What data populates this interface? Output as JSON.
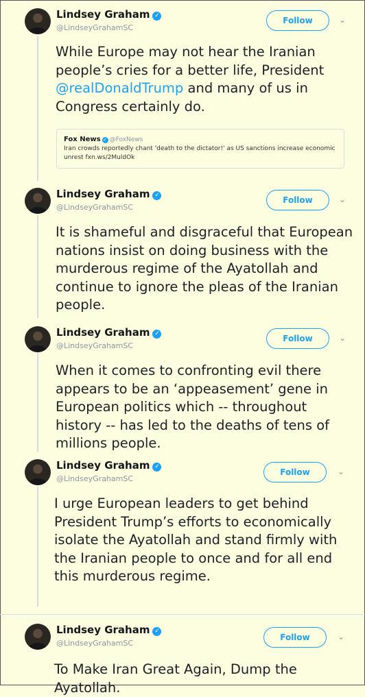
{
  "tweets": [
    {
      "name": "Lindsey Graham",
      "handle": "@LindseyGrahamSC",
      "follow_label": "Follow",
      "text_before": "While Europe may not hear the Iranian people’s cries for a better life, President ",
      "mention": "@realDonaldTrump",
      "text_after": " and many of us in Congress certainly do.",
      "quote": {
        "name": "Fox News",
        "handle": "@FoxNews",
        "text": "Iran crowds reportedly chant 'death to the dictator!' as US sanctions increase economic unrest fxn.ws/2MuldOk"
      }
    },
    {
      "name": "Lindsey Graham",
      "handle": "@LindseyGrahamSC",
      "follow_label": "Follow",
      "text": "It is shameful and disgraceful that European nations insist on doing business with the murderous regime of the Ayatollah and continue to ignore the pleas of the Iranian people."
    },
    {
      "name": "Lindsey Graham",
      "handle": "@LindseyGrahamSC",
      "follow_label": "Follow",
      "text": "When it comes to confronting evil there appears to be an ‘appeasement’ gene in European politics which -- throughout history -- has led to the deaths of tens of millions people."
    },
    {
      "name": "Lindsey Graham",
      "handle": "@LindseyGrahamSC",
      "follow_label": "Follow",
      "text": "I urge European leaders to get behind President Trump’s efforts to economically isolate the Ayatollah and stand firmly with the Iranian people to once and for all end this murderous regime."
    },
    {
      "name": "Lindsey Graham",
      "handle": "@LindseyGrahamSC",
      "follow_label": "Follow",
      "text": "To Make Iran Great Again, Dump the Ayatollah."
    }
  ],
  "icons": {
    "verified": "verified-badge-icon",
    "more": "chevron-down-icon"
  },
  "colors": {
    "background": "#fdfde0",
    "accent": "#1da1f2",
    "text": "#1c2126",
    "muted": "#8a969f"
  }
}
